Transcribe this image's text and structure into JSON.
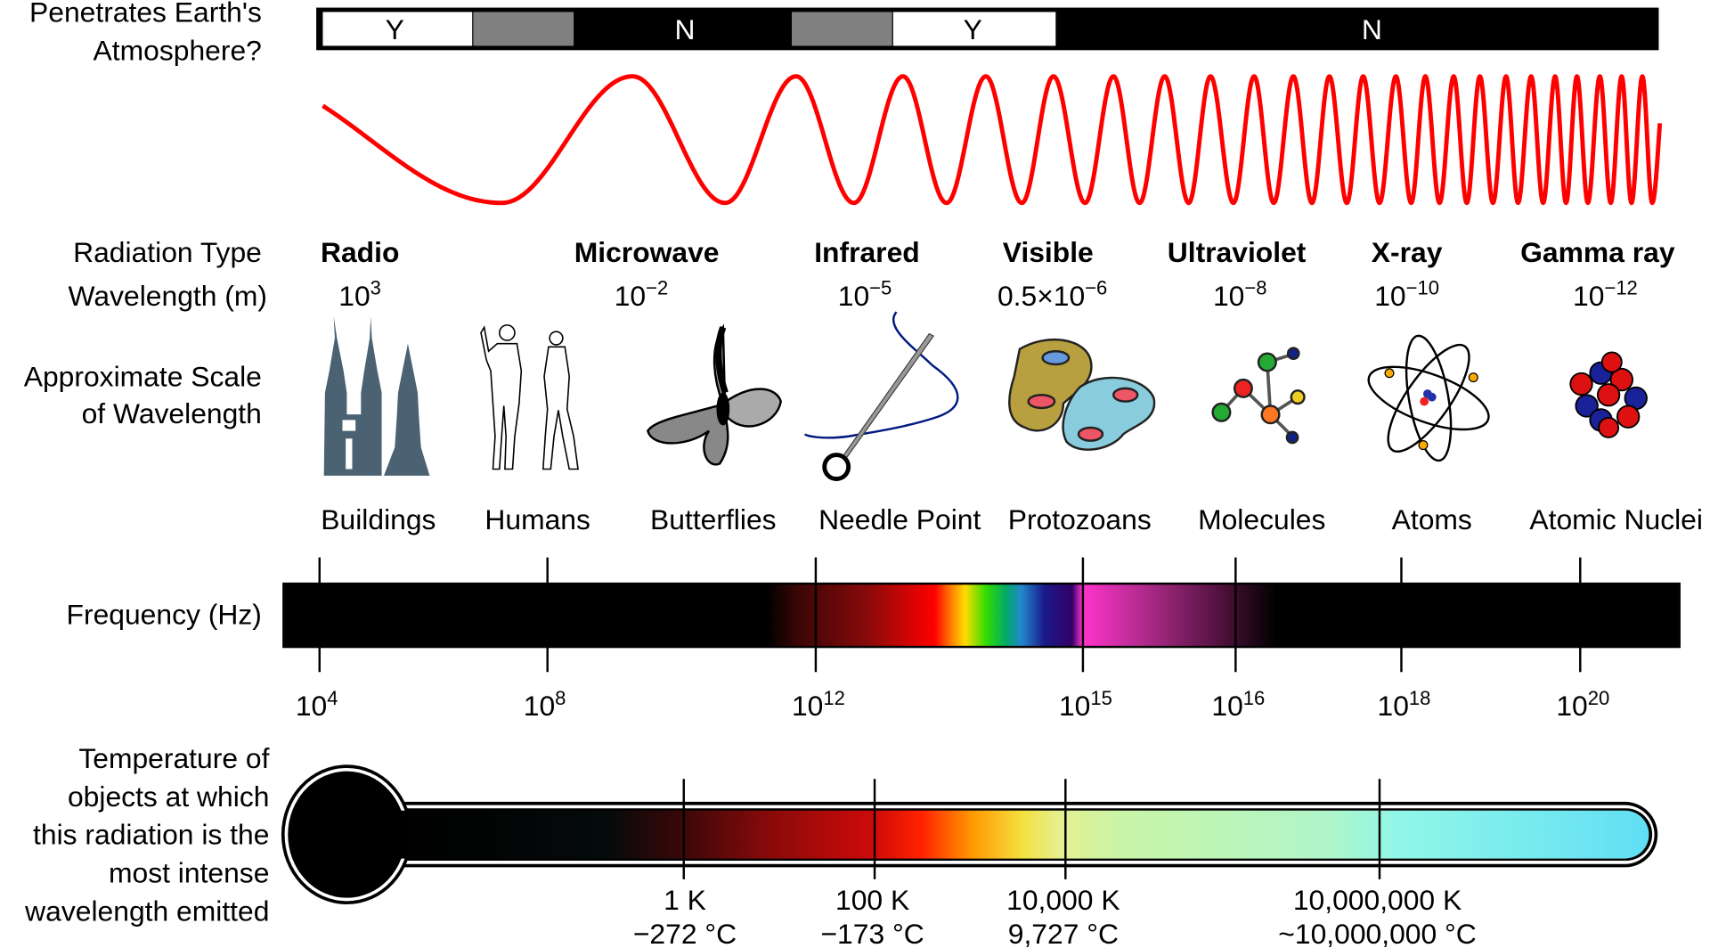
{
  "atmosphere": {
    "label_line1": "Penetrates Earth's",
    "label_line2": "Atmosphere?",
    "segments": [
      {
        "label": "Y",
        "fill": "#ffffff"
      },
      {
        "label": "",
        "fill": "#808080"
      },
      {
        "label": "N",
        "fill": "#000000"
      },
      {
        "label": "",
        "fill": "#808080"
      },
      {
        "label": "Y",
        "fill": "#ffffff"
      },
      {
        "label": "N",
        "fill": "#000000"
      }
    ]
  },
  "wave": {
    "color": "#ff0000"
  },
  "row_labels": {
    "radiation_type": "Radiation Type",
    "wavelength": "Wavelength (m)",
    "scale_line1": "Approximate Scale",
    "scale_line2": "of Wavelength",
    "frequency": "Frequency (Hz)",
    "temperature_lines": [
      "Temperature of",
      "objects at which",
      "this radiation is the",
      "most intense",
      "wavelength emitted"
    ]
  },
  "radiation_types": [
    {
      "name": "Radio",
      "wl_base": "10",
      "wl_exp": "3"
    },
    {
      "name": "Microwave",
      "wl_base": "10",
      "wl_exp": "−2"
    },
    {
      "name": "Infrared",
      "wl_base": "10",
      "wl_exp": "−5"
    },
    {
      "name": "Visible",
      "wl_base": "0.5×10",
      "wl_exp": "−6"
    },
    {
      "name": "Ultraviolet",
      "wl_base": "10",
      "wl_exp": "−8"
    },
    {
      "name": "X-ray",
      "wl_base": "10",
      "wl_exp": "−10"
    },
    {
      "name": "Gamma ray",
      "wl_base": "10",
      "wl_exp": "−12"
    }
  ],
  "scales": [
    {
      "label": "Buildings",
      "icon": "buildings-icon"
    },
    {
      "label": "Humans",
      "icon": "humans-icon"
    },
    {
      "label": "Butterflies",
      "icon": "butterfly-icon"
    },
    {
      "label": "Needle Point",
      "icon": "needle-icon"
    },
    {
      "label": "Protozoans",
      "icon": "protozoa-icon"
    },
    {
      "label": "Molecules",
      "icon": "molecule-icon"
    },
    {
      "label": "Atoms",
      "icon": "atom-icon"
    },
    {
      "label": "Atomic Nuclei",
      "icon": "nucleus-icon"
    }
  ],
  "frequency_ticks": [
    {
      "base": "10",
      "exp": "4"
    },
    {
      "base": "10",
      "exp": "8"
    },
    {
      "base": "10",
      "exp": "12"
    },
    {
      "base": "10",
      "exp": "15"
    },
    {
      "base": "10",
      "exp": "16"
    },
    {
      "base": "10",
      "exp": "18"
    },
    {
      "base": "10",
      "exp": "20"
    }
  ],
  "temperature_ticks": [
    {
      "kelvin": "1 K",
      "celsius": "−272 °C"
    },
    {
      "kelvin": "100 K",
      "celsius": "−173 °C"
    },
    {
      "kelvin": "10,000 K",
      "celsius": "9,727 °C"
    },
    {
      "kelvin": "10,000,000 K",
      "celsius": "~10,000,000 °C"
    }
  ]
}
